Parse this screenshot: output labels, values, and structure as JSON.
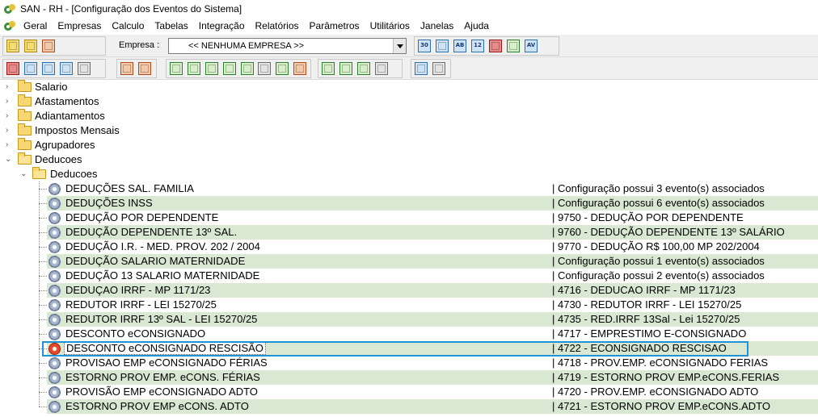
{
  "window": {
    "title": "SAN - RH - [Configuração dos Eventos do Sistema]"
  },
  "menu": {
    "items": [
      "Geral",
      "Empresas",
      "Calculo",
      "Tabelas",
      "Integração",
      "Relatórios",
      "Parâmetros",
      "Utilitários",
      "Janelas",
      "Ajuda"
    ]
  },
  "toolbar": {
    "empresa_label": "Empresa :",
    "empresa_value": "<< NENHUMA EMPRESA >>",
    "right_icons": [
      "30",
      "",
      "AB",
      "12",
      "",
      "",
      "AV"
    ]
  },
  "tree": {
    "folders": [
      "Salario",
      "Afastamentos",
      "Adiantamentos",
      "Impostos Mensais",
      "Agrupadores",
      "Deducoes"
    ],
    "subfolder": "Deducoes",
    "events": [
      {
        "name": "DEDUÇÕES SAL. FAMILIA",
        "desc": "| Configuração possui 3 evento(s) associados"
      },
      {
        "name": "DEDUÇÕES INSS",
        "desc": "| Configuração possui 6 evento(s) associados"
      },
      {
        "name": "DEDUÇÃO POR DEPENDENTE",
        "desc": "| 9750 - DEDUÇÃO POR DEPENDENTE"
      },
      {
        "name": "DEDUÇÃO DEPENDENTE 13º SAL.",
        "desc": "| 9760 - DEDUÇÃO DEPENDENTE 13º SALÁRIO"
      },
      {
        "name": "DEDUÇÃO I.R. - MED. PROV. 202 / 2004",
        "desc": "| 9770 - DEDUÇÃO R$ 100,00 MP 202/2004"
      },
      {
        "name": "DEDUÇÃO SALARIO MATERNIDADE",
        "desc": "| Configuração possui 1 evento(s) associados"
      },
      {
        "name": "DEDUÇÃO 13 SALARIO MATERNIDADE",
        "desc": "| Configuração possui 2 evento(s) associados"
      },
      {
        "name": "DEDUÇAO IRRF - MP 1171/23",
        "desc": "| 4716 - DEDUCAO IRRF - MP 1171/23"
      },
      {
        "name": "REDUTOR IRRF - LEI 15270/25",
        "desc": "| 4730 - REDUTOR IRRF - LEI 15270/25"
      },
      {
        "name": "REDUTOR IRRF  13º SAL - LEI 15270/25",
        "desc": "| 4735 - RED.IRRF 13Sal - Lei 15270/25"
      },
      {
        "name": "DESCONTO eCONSIGNADO",
        "desc": "| 4717 - EMPRESTIMO E-CONSIGNADO"
      },
      {
        "name": "DESCONTO eCONSIGNADO RESCISÃO",
        "desc": "| 4722 - ECONSIGNADO RESCISAO"
      },
      {
        "name": "PROVISAO EMP eCONSIGNADO FÉRIAS",
        "desc": "| 4718 - PROV.EMP. eCONSIGNADO FERIAS"
      },
      {
        "name": "ESTORNO PROV EMP. eCONS. FÉRIAS",
        "desc": "| 4719 - ESTORNO PROV EMP.eCONS.FERIAS"
      },
      {
        "name": "PROVISÃO EMP eCONSIGNADO ADTO",
        "desc": "| 4720 - PROV.EMP. eCONSIGNADO ADTO"
      },
      {
        "name": "ESTORNO PROV EMP eCONS. ADTO",
        "desc": "| 4721 - ESTORNO PROV EMP.eCONS.ADTO"
      }
    ]
  },
  "colors": {
    "alt_row": "#d8e8d2",
    "selection_border": "#1e94d6"
  }
}
